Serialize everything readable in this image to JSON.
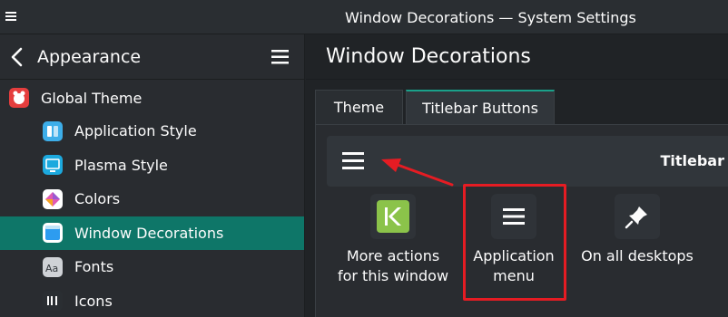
{
  "window": {
    "title": "Window Decorations — System Settings"
  },
  "sidebar": {
    "header_title": "Appearance",
    "items": [
      {
        "label": "Global Theme",
        "icon": "global-theme-icon",
        "color": "#e53e3e",
        "active": false
      },
      {
        "label": "Application Style",
        "icon": "application-style-icon",
        "color": "#3daee9",
        "active": false
      },
      {
        "label": "Plasma Style",
        "icon": "plasma-style-icon",
        "color": "#1ca9de",
        "active": false
      },
      {
        "label": "Colors",
        "icon": "colors-icon",
        "color": "#e05ab4",
        "active": false
      },
      {
        "label": "Window Decorations",
        "icon": "window-decorations-icon",
        "color": "#2d9cf0",
        "active": true
      },
      {
        "label": "Fonts",
        "icon": "fonts-icon",
        "color": "#cfd2d6",
        "active": false
      },
      {
        "label": "Icons",
        "icon": "icons-icon",
        "color": "#2a2e32",
        "active": false
      }
    ]
  },
  "content": {
    "title": "Window Decorations",
    "tabs": [
      {
        "label": "Theme",
        "active": false
      },
      {
        "label": "Titlebar Buttons",
        "active": true
      }
    ],
    "preview": {
      "label": "Titlebar"
    },
    "buttons": [
      {
        "label_line1": "More actions",
        "label_line2": "for this window",
        "icon": "kde-more-actions-icon"
      },
      {
        "label_line1": "Application",
        "label_line2": "menu",
        "icon": "application-menu-icon"
      },
      {
        "label_line1": "On all desktops",
        "label_line2": "",
        "icon": "pin-icon"
      }
    ]
  },
  "colors": {
    "accent": "#1aa18a",
    "selection": "#0e7668",
    "annotation": "#e51c23"
  }
}
